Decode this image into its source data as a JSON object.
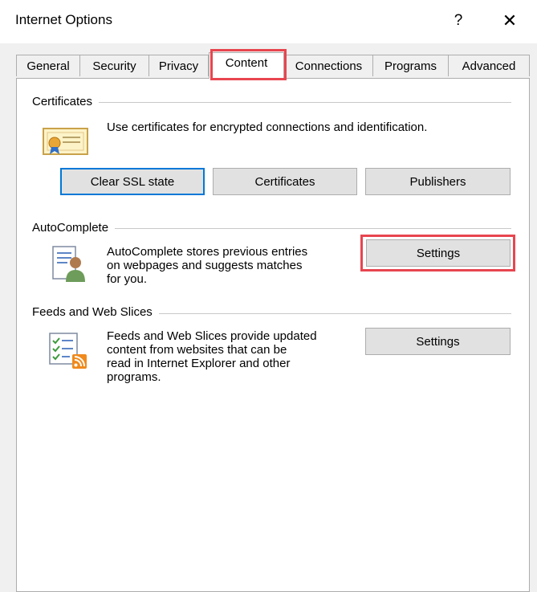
{
  "window": {
    "title": "Internet Options",
    "help_glyph": "?",
    "close_glyph": "✕"
  },
  "tabs": [
    {
      "label": "General"
    },
    {
      "label": "Security"
    },
    {
      "label": "Privacy"
    },
    {
      "label": "Content",
      "active": true
    },
    {
      "label": "Connections"
    },
    {
      "label": "Programs"
    },
    {
      "label": "Advanced"
    }
  ],
  "certificates": {
    "group_label": "Certificates",
    "description": "Use certificates for encrypted connections and identification.",
    "icon": "certificate-icon",
    "buttons": {
      "clear_ssl": "Clear SSL state",
      "certificates": "Certificates",
      "publishers": "Publishers"
    }
  },
  "autocomplete": {
    "group_label": "AutoComplete",
    "description_lines": [
      "AutoComplete stores previous entries",
      "on webpages and suggests matches",
      "for you."
    ],
    "icon": "autocomplete-user-icon",
    "settings_label": "Settings"
  },
  "feeds": {
    "group_label": "Feeds and Web Slices",
    "description_lines": [
      "Feeds and Web Slices provide updated",
      "content from websites that can be",
      "read in Internet Explorer and other",
      "programs."
    ],
    "icon": "feeds-rss-icon",
    "settings_label": "Settings"
  },
  "colors": {
    "highlight": "#e8454f",
    "focus": "#0078d7"
  }
}
